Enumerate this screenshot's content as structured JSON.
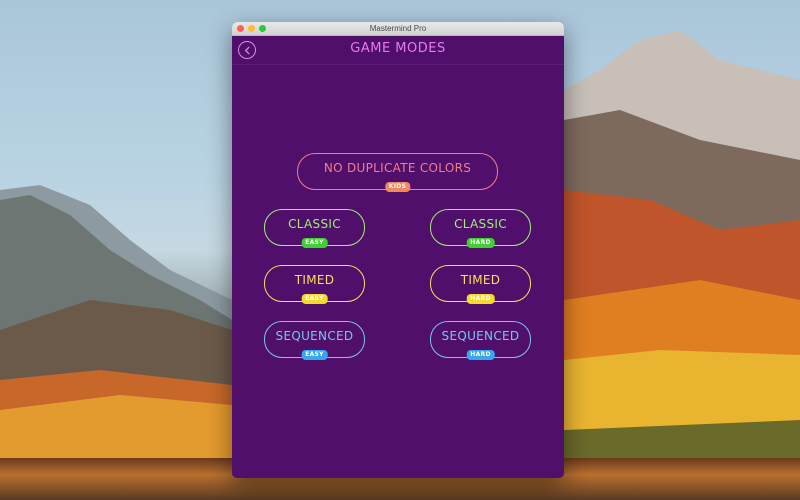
{
  "window": {
    "title": "Mastermind Pro"
  },
  "header": {
    "title": "GAME MODES"
  },
  "modes": [
    {
      "label": "NO DUPLICATE COLORS",
      "badge": "KIDS",
      "color": "#f27e8a",
      "badge_color": "#f1885f"
    },
    {
      "label": "CLASSIC",
      "badge": "EASY",
      "color": "#9ef078",
      "badge_color": "#3ed12f"
    },
    {
      "label": "CLASSIC",
      "badge": "HARD",
      "color": "#9ef078",
      "badge_color": "#3ed12f"
    },
    {
      "label": "TIMED",
      "badge": "EASY",
      "color": "#f8e05a",
      "badge_color": "#f3da2b"
    },
    {
      "label": "TIMED",
      "badge": "HARD",
      "color": "#f8e05a",
      "badge_color": "#f3da2b"
    },
    {
      "label": "SEQUENCED",
      "badge": "EASY",
      "color": "#7ac4f2",
      "badge_color": "#36a8ef"
    },
    {
      "label": "SEQUENCED",
      "badge": "HARD",
      "color": "#7ac4f2",
      "badge_color": "#36a8ef"
    }
  ],
  "colors": {
    "window_bg": "#4f0f6b",
    "accent": "#e67ce9"
  }
}
